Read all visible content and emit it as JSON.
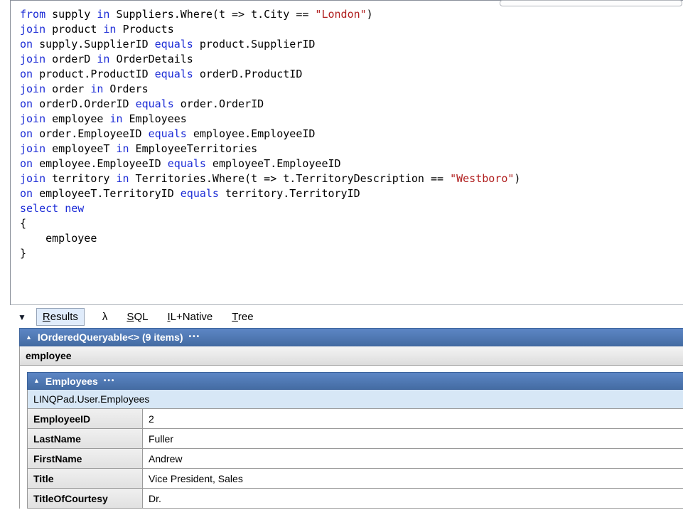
{
  "colors": {
    "keyword": "#1b2bd6",
    "string": "#b01e1e",
    "header_blue": "#4d74ad",
    "type_row_blue": "#d7e7f6"
  },
  "editor": {
    "lines": [
      [
        [
          "from",
          "k"
        ],
        [
          " supply ",
          ""
        ],
        [
          "in",
          "k"
        ],
        [
          " Suppliers.Where(t => t.City == ",
          ""
        ],
        [
          "\"London\"",
          "s"
        ],
        [
          ")",
          ""
        ]
      ],
      [
        [
          "join",
          "k"
        ],
        [
          " product ",
          ""
        ],
        [
          "in",
          "k"
        ],
        [
          " Products",
          ""
        ]
      ],
      [
        [
          "on",
          "k"
        ],
        [
          " supply.SupplierID ",
          ""
        ],
        [
          "equals",
          "k"
        ],
        [
          " product.SupplierID",
          ""
        ]
      ],
      [
        [
          "join",
          "k"
        ],
        [
          " orderD ",
          ""
        ],
        [
          "in",
          "k"
        ],
        [
          " OrderDetails",
          ""
        ]
      ],
      [
        [
          "on",
          "k"
        ],
        [
          " product.ProductID ",
          ""
        ],
        [
          "equals",
          "k"
        ],
        [
          " orderD.ProductID",
          ""
        ]
      ],
      [
        [
          "join",
          "k"
        ],
        [
          " order ",
          ""
        ],
        [
          "in",
          "k"
        ],
        [
          " Orders",
          ""
        ]
      ],
      [
        [
          "on",
          "k"
        ],
        [
          " orderD.OrderID ",
          ""
        ],
        [
          "equals",
          "k"
        ],
        [
          " order.OrderID",
          ""
        ]
      ],
      [
        [
          "join",
          "k"
        ],
        [
          " employee ",
          ""
        ],
        [
          "in",
          "k"
        ],
        [
          " Employees",
          ""
        ]
      ],
      [
        [
          "on",
          "k"
        ],
        [
          " order.EmployeeID ",
          ""
        ],
        [
          "equals",
          "k"
        ],
        [
          " employee.EmployeeID",
          ""
        ]
      ],
      [
        [
          "join",
          "k"
        ],
        [
          " employeeT ",
          ""
        ],
        [
          "in",
          "k"
        ],
        [
          " EmployeeTerritories",
          ""
        ]
      ],
      [
        [
          "on",
          "k"
        ],
        [
          " employee.EmployeeID ",
          ""
        ],
        [
          "equals",
          "k"
        ],
        [
          " employeeT.EmployeeID",
          ""
        ]
      ],
      [
        [
          "join",
          "k"
        ],
        [
          " territory ",
          ""
        ],
        [
          "in",
          "k"
        ],
        [
          " Territories.Where(t => t.TerritoryDescription == ",
          ""
        ],
        [
          "\"Westboro\"",
          "s"
        ],
        [
          ")",
          ""
        ]
      ],
      [
        [
          "on",
          "k"
        ],
        [
          " employeeT.TerritoryID ",
          ""
        ],
        [
          "equals",
          "k"
        ],
        [
          " territory.TerritoryID",
          ""
        ]
      ],
      [
        [
          "select",
          "k"
        ],
        [
          " ",
          ""
        ],
        [
          "new",
          "k"
        ]
      ],
      [
        [
          "{",
          ""
        ]
      ],
      [
        [
          "    employee",
          ""
        ]
      ],
      [
        [
          "}",
          ""
        ]
      ]
    ]
  },
  "tabs": {
    "collapse_arrow": "▼",
    "items": [
      {
        "id": "results",
        "label": "Results",
        "accel": true,
        "selected": true
      },
      {
        "id": "lambda",
        "label": "λ",
        "accel": false,
        "selected": false
      },
      {
        "id": "sql",
        "label": "SQL",
        "accel": true,
        "selected": false
      },
      {
        "id": "il-native",
        "label": "IL+Native",
        "accel": true,
        "selected": false
      },
      {
        "id": "tree",
        "label": "Tree",
        "accel": true,
        "selected": false
      }
    ]
  },
  "results": {
    "collapse_arrow": "▲",
    "ellipsis": "•••",
    "root_header": "IOrderedQueryable<> (9 items)",
    "column_header": "employee",
    "employees": {
      "header": "Employees",
      "type_name": "LINQPad.User.Employees",
      "rows": [
        {
          "name": "EmployeeID",
          "value": "2"
        },
        {
          "name": "LastName",
          "value": "Fuller"
        },
        {
          "name": "FirstName",
          "value": "Andrew"
        },
        {
          "name": "Title",
          "value": "Vice President, Sales"
        },
        {
          "name": "TitleOfCourtesy",
          "value": "Dr."
        }
      ]
    }
  }
}
